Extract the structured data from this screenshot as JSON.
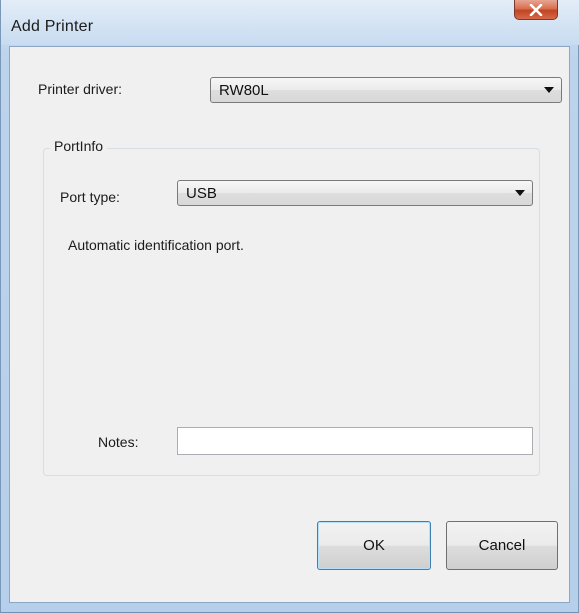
{
  "window": {
    "title": "Add Printer",
    "close_icon": "close-x-icon"
  },
  "printer_driver": {
    "label": "Printer driver:",
    "selected": "RW80L"
  },
  "port_info": {
    "group_title": "PortInfo",
    "port_type_label": "Port type:",
    "port_type_selected": "USB",
    "description": "Automatic identification port.",
    "notes_label": "Notes:",
    "notes_value": ""
  },
  "buttons": {
    "ok_label": "OK",
    "cancel_label": "Cancel"
  },
  "colors": {
    "close_button": "#c24422",
    "frame": "#bcd3ec",
    "client_background": "#f0f0f0"
  }
}
